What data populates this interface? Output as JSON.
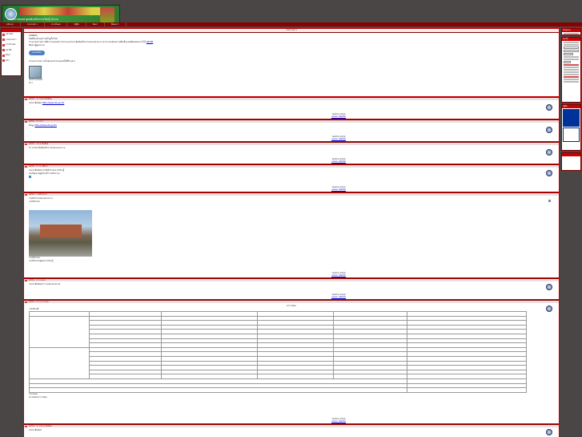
{
  "header": {
    "subtitle": "ระบบสารสนเทศ ศูนย์ส่งเสริมการเรียนรู้ อำเภอ"
  },
  "nav": {
    "items": [
      "หน้าแรก",
      "กระดานข่าว",
      "ดาวน์โหลด",
      "ปฏิทิน",
      "ค้นหา",
      "ติดต่อเรา"
    ]
  },
  "left": {
    "items": [
      "หน้าหลัก",
      "กระดานข่าว",
      "ดาวน์โหลด",
      "สมาชิก",
      "ค้นหา",
      "ออก"
    ]
  },
  "main": {
    "header_title": "กระดานข่าว",
    "intro": {
      "line1": "สวัสดีครับ",
      "line2": "ยินดีต้อนรับทุกท่านเข้าสู่เว็บไซต์",
      "line3": "ระบบกระดานข่าวเพื่อการเผยแพร่ข่าวสารและประชาสัมพันธ์กิจกรรมของหน่วยงาน สามารถแสดงความคิดเห็นและติดต่อสอบถามได้",
      "link": "คลิกที่นี่",
      "line4": "ติดต่อ ผู้ดูแลระบบ",
      "button": "ลงทะเบียน",
      "line5": "ท่านสามารถดาวน์โหลดเอกสารเผยแพร่ได้ที่ด้านล่าง",
      "thumb_caption": "เอกสารเผยแพร่",
      "last": "ข่าว"
    },
    "posts": [
      {
        "author": "admin",
        "title": "ข่าวประชาสัมพันธ์",
        "text": "ประชาสัมพันธ์",
        "link": "http://www.nfe.go.th/",
        "foot1": "โพสต์โดย admin",
        "foot2": "แสดงความคิดเห็น"
      },
      {
        "author": "admin",
        "title": "ข่าวสาร",
        "text": "ข้อมูล",
        "link": "http://www.nfe.go.th/",
        "foot1": "โพสต์โดย admin",
        "foot2": "แสดงความคิดเห็น"
      },
      {
        "author": "admin",
        "title": "ประชาสัมพันธ์",
        "text": "ข่าวประชาสัมพันธ์กิจกรรมของหน่วยงาน",
        "foot1": "โพสต์โดย admin",
        "foot2": "แสดงความคิดเห็น"
      },
      {
        "author": "admin",
        "title": "ข่าวการศึกษา",
        "text": "ประชาสัมพันธ์การจัดกิจกรรมการเรียนรู้",
        "text2": "ขอเชิญชวนผู้สนใจเข้าร่วมกิจกรรม",
        "foot1": "โพสต์โดย admin",
        "foot2": "แสดงความคิดเห็น"
      },
      {
        "author": "admin",
        "title": "ภาพกิจกรรม",
        "text": "ภาพกิจกรรมของหน่วยงาน",
        "text2": "ภาพกิจกรรม",
        "caption1": "ภาพกิจกรรม",
        "caption2": "ภาพกิจกรรมศูนย์การเรียนรู้",
        "foot1": "โพสต์โดย admin",
        "foot2": "แสดงความคิดเห็น"
      },
      {
        "author": "admin",
        "title": "ตารางสอบ",
        "text": "ประชาสัมพันธ์ตารางสอบปลายภาค",
        "foot1": "โพสต์โดย admin",
        "foot2": "แสดงความคิดเห็น"
      },
      {
        "author": "admin",
        "title": "ตารางการสอบ",
        "table_title": "ตารางสอบ",
        "sub": "ภาคเรียนที่",
        "note1": "หมายเหตุ",
        "note2": "ตรวจสอบตารางสอบ",
        "foot1": "โพสต์โดย admin",
        "foot2": "แสดงความคิดเห็น"
      },
      {
        "author": "admin",
        "title": "ข่าวประชาสัมพันธ์",
        "text": "ประชาสัมพันธ์"
      }
    ]
  },
  "right": {
    "box1": "เข้าสู่ระบบ",
    "box2": "สมาชิก",
    "box3": "ปฏิทิน"
  },
  "colors": {
    "frame": "#c00000",
    "background": "#4a4646",
    "accent": "#003399"
  }
}
